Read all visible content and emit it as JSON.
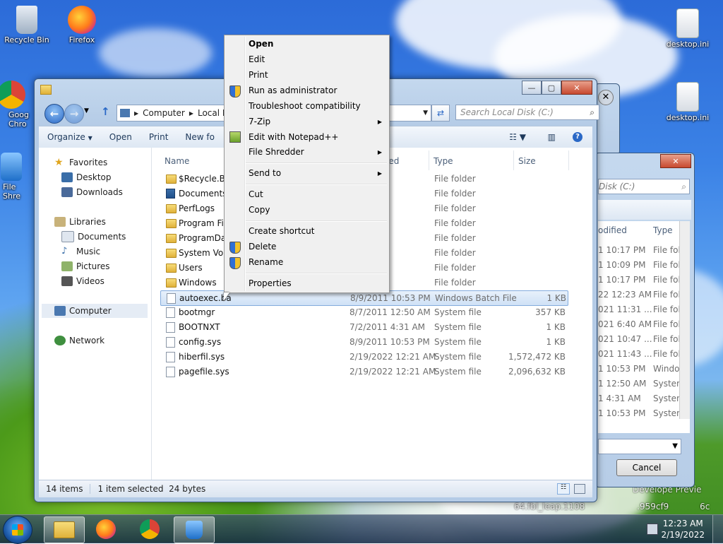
{
  "desktop": {
    "icons": [
      {
        "label": "Recycle Bin"
      },
      {
        "label": "Firefox"
      },
      {
        "label": "Goog Chro"
      },
      {
        "label": "File Shre"
      },
      {
        "label": "desktop.ini"
      },
      {
        "label": "desktop.ini"
      }
    ]
  },
  "explorer": {
    "address": {
      "crumbs": [
        "Computer",
        "Local D"
      ]
    },
    "search_placeholder": "Search Local Disk (C:)",
    "toolbar": {
      "organize": "Organize",
      "open": "Open",
      "print": "Print",
      "newfolder": "New fo"
    },
    "nav": {
      "favorites": "Favorites",
      "desktop": "Desktop",
      "downloads": "Downloads",
      "libraries": "Libraries",
      "documents": "Documents",
      "music": "Music",
      "pictures": "Pictures",
      "videos": "Videos",
      "computer": "Computer",
      "network": "Network"
    },
    "columns": {
      "name": "Name",
      "modified": "ied",
      "type": "Type",
      "size": "Size"
    },
    "files": [
      {
        "name": "$Recycle.Bin",
        "date": ":17 PM",
        "type": "File folder",
        "size": ""
      },
      {
        "name": "Documents",
        "date": ":09 PM",
        "type": "File folder",
        "size": ""
      },
      {
        "name": "PerfLogs",
        "date": ":17 PM",
        "type": "File folder",
        "size": ""
      },
      {
        "name": "Program File",
        "date": ":23 AM",
        "type": "File folder",
        "size": ""
      },
      {
        "name": "ProgramDat",
        "date": "11:31 ...",
        "type": "File folder",
        "size": ""
      },
      {
        "name": "System Volu",
        "date": "6:40 AM",
        "type": "File folder",
        "size": ""
      },
      {
        "name": "Users",
        "date": "10:47 ...",
        "type": "File folder",
        "size": ""
      },
      {
        "name": "Windows",
        "date": "11:43 ...",
        "type": "File folder",
        "size": ""
      },
      {
        "name": "autoexec.ba",
        "date": "8/9/2011 10:53 PM",
        "type": "Windows Batch File",
        "size": "1 KB"
      },
      {
        "name": "bootmgr",
        "date": "8/7/2011 12:50 AM",
        "type": "System file",
        "size": "357 KB"
      },
      {
        "name": "BOOTNXT",
        "date": "7/2/2011 4:31 AM",
        "type": "System file",
        "size": "1 KB"
      },
      {
        "name": "config.sys",
        "date": "8/9/2011 10:53 PM",
        "type": "System file",
        "size": "1 KB"
      },
      {
        "name": "hiberfil.sys",
        "date": "2/19/2022 12:21 AM",
        "type": "System file",
        "size": "1,572,472 KB"
      },
      {
        "name": "pagefile.sys",
        "date": "2/19/2022 12:21 AM",
        "type": "System file",
        "size": "2,096,632 KB"
      }
    ],
    "status": {
      "count": "14 items",
      "selected": "1 item selected  24 bytes"
    }
  },
  "context_menu": {
    "open": "Open",
    "edit": "Edit",
    "print": "Print",
    "run_admin": "Run as administrator",
    "troubleshoot": "Troubleshoot compatibility",
    "zip": "7-Zip",
    "notepadpp": "Edit with Notepad++",
    "shredder": "File Shredder",
    "sendto": "Send to",
    "cut": "Cut",
    "copy": "Copy",
    "shortcut": "Create shortcut",
    "delete": "Delete",
    "rename": "Rename",
    "properties": "Properties"
  },
  "bg_dialog": {
    "search": "Disk (C:)",
    "col_modified": "odified",
    "col_type": "Type",
    "rows": [
      {
        "date": "1 10:17 PM",
        "type": "File fol"
      },
      {
        "date": "1 10:09 PM",
        "type": "File fol"
      },
      {
        "date": "1 10:17 PM",
        "type": "File fol"
      },
      {
        "date": "22 12:23 AM",
        "type": "File fol"
      },
      {
        "date": "021 11:31 ...",
        "type": "File fol"
      },
      {
        "date": "021 6:40 AM",
        "type": "File fol"
      },
      {
        "date": "021 10:47 ...",
        "type": "File fol"
      },
      {
        "date": "021 11:43 ...",
        "type": "File fol"
      },
      {
        "date": "1 10:53 PM",
        "type": "Windo"
      },
      {
        "date": "1 12:50 AM",
        "type": "Systen"
      },
      {
        "date": "1 4:31 AM",
        "type": "Systen"
      },
      {
        "date": "1 10:53 PM",
        "type": "Systen"
      }
    ],
    "cancel": "Cancel"
  },
  "watermark": {
    "line1": "Develope Previe",
    "line2": "64.fbl_leap.1108",
    "line3": ".959cf9",
    "line4": "6c"
  },
  "taskbar": {
    "time": "12:23 AM",
    "date": "2/19/2022"
  }
}
